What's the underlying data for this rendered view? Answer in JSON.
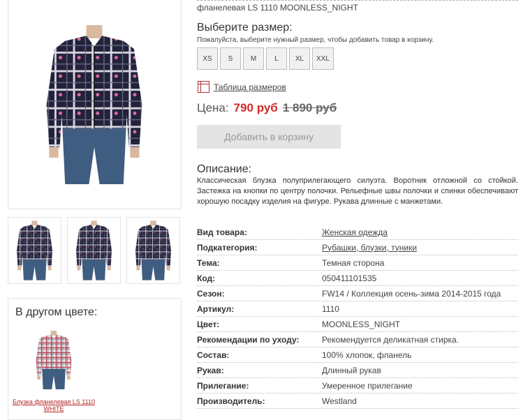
{
  "product": {
    "name_fragment": "фланелевая LS 1110 MOONLESS_NIGHT"
  },
  "size": {
    "title": "Выберите размер:",
    "hint": "Пожалуйста, выберите нужный размер, чтобы добавить товар в корзину.",
    "options": [
      "XS",
      "S",
      "M",
      "L",
      "XL",
      "XXL"
    ],
    "table_link": "Таблица размеров"
  },
  "price": {
    "label": "Цена:",
    "current": "790 руб",
    "old": "1 890 руб"
  },
  "cart": {
    "button_label": "Добавить в корзину"
  },
  "description": {
    "title": "Описание:",
    "text": "Классическая блузка полуприлегающего силуэта. Воротник отложной со стойкой. Застежка на кнопки по центру полочки. Рельефные швы полочки и спинки обеспечивают хорошую посадку изделия на фигуре. Рукава длинные с манжетами."
  },
  "attributes": [
    {
      "key": "Вид товара:",
      "value": "Женская одежда"
    },
    {
      "key": "Подкатегория:",
      "value": "Рубашки, блузки, туники"
    },
    {
      "key": "Тема:",
      "value": "Темная сторона"
    },
    {
      "key": "Код:",
      "value": "050411101535"
    },
    {
      "key": "Сезон:",
      "value": "FW14 / Коллекция осень-зима 2014-2015 года"
    },
    {
      "key": "Артикул:",
      "value": "1110"
    },
    {
      "key": "Цвет:",
      "value": "MOONLESS_NIGHT"
    },
    {
      "key": "Рекомендации по уходу:",
      "value": "Рекомендуется деликатная стирка."
    },
    {
      "key": "Состав:",
      "value": "100% хлопок, фланель"
    },
    {
      "key": "Рукав:",
      "value": "Длинный рукав"
    },
    {
      "key": "Прилегание:",
      "value": "Умеренное прилегание"
    },
    {
      "key": "Производитель:",
      "value": "Westland"
    }
  ],
  "other_color": {
    "title": "В другом цвете:",
    "link": "Блузка фланелевая LS 1110 WHITE"
  },
  "colors": {
    "price_red": "#d42a2a",
    "shirt_dark": "#22223a",
    "shirt_light": "#efe8ec",
    "link_red": "#b22222"
  }
}
